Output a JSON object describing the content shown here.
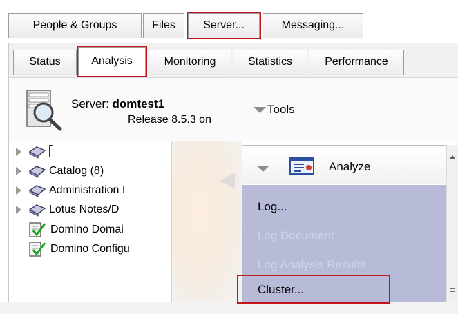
{
  "top_tabs": [
    {
      "label": "People & Groups"
    },
    {
      "label": "Files"
    },
    {
      "label": "Server..."
    },
    {
      "label": "Messaging..."
    }
  ],
  "sub_tabs": [
    {
      "label": "Status"
    },
    {
      "label": "Analysis"
    },
    {
      "label": "Monitoring"
    },
    {
      "label": "Statistics"
    },
    {
      "label": "Performance"
    }
  ],
  "server_info": {
    "prefix": "Server: ",
    "name": "domtest1",
    "release": "Release 8.5.3 on"
  },
  "tools": {
    "label": "Tools"
  },
  "tree": {
    "items": [
      {
        "label": "",
        "icon": "book-icon"
      },
      {
        "label": "Catalog (8)",
        "icon": "book-icon"
      },
      {
        "label": "Administration I",
        "icon": "book-icon"
      },
      {
        "label": "Lotus Notes/D",
        "icon": "book-icon"
      },
      {
        "label": "Domino Domai",
        "icon": "checked-document-icon"
      },
      {
        "label": "Domino Configu",
        "icon": "checked-document-icon"
      }
    ]
  },
  "analyze": {
    "header": "Analyze",
    "items": [
      {
        "label": "Log...",
        "enabled": true
      },
      {
        "label": "Log Document",
        "enabled": false
      },
      {
        "label": "Log Analysis Results",
        "enabled": false
      },
      {
        "label": "Cluster...",
        "enabled": true
      }
    ]
  },
  "colors": {
    "highlight_outline": "#c4151c",
    "analyze_panel": "#b8bbd8",
    "disabled_text": "#cfd2e8"
  }
}
